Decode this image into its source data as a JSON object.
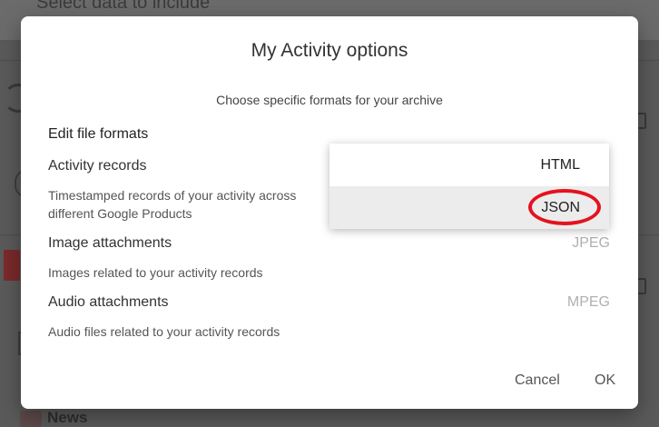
{
  "background": {
    "page_title": "Select data to include",
    "news_label": "News"
  },
  "dialog": {
    "title": "My Activity options",
    "subtitle": "Choose specific formats for your archive",
    "section_heading": "Edit file formats",
    "rows": [
      {
        "label": "Activity records",
        "description": "Timestamped records of your activity across different Google Products",
        "format": "JSON"
      },
      {
        "label": "Image attachments",
        "description": "Images related to your activity records",
        "format": "JPEG"
      },
      {
        "label": "Audio attachments",
        "description": "Audio files related to your activity records",
        "format": "MPEG"
      }
    ],
    "format_menu": {
      "options": [
        "HTML",
        "JSON"
      ],
      "selected": "JSON",
      "highlight_color": "#e3131f"
    },
    "cancel_label": "Cancel",
    "ok_label": "OK"
  }
}
